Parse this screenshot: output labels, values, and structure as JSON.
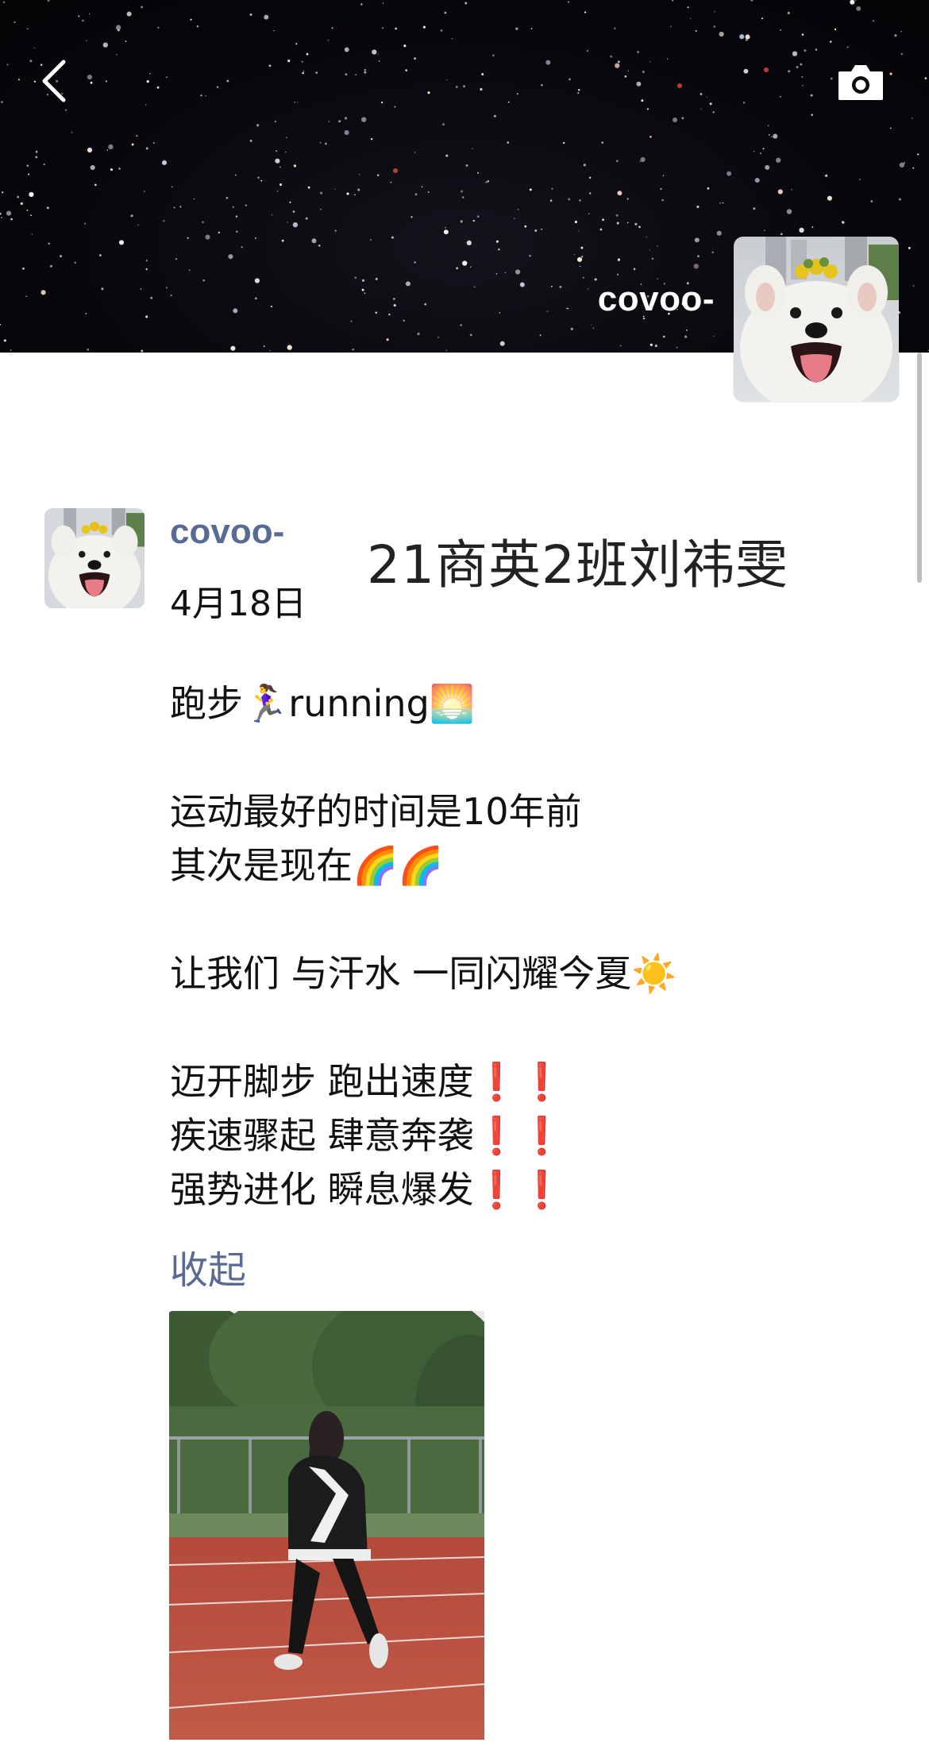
{
  "header": {
    "username": "covoo-",
    "background": "starry-night-sky",
    "icons": {
      "back": "chevron-left-icon",
      "camera": "camera-icon"
    }
  },
  "post": {
    "username": "covoo-",
    "date": "4月18日",
    "title_overlay": "21商英2班刘祎雯",
    "lines": [
      "跑步🏃‍♀️running🌅",
      "",
      "运动最好的时间是10年前",
      "其次是现在🌈🌈",
      "",
      "让我们 与汗水 一同闪耀今夏☀️",
      "",
      "迈开脚步 跑出速度❗❗",
      "疾速骤起 肆意奔袭❗❗",
      "强势进化 瞬息爆发❗❗"
    ],
    "collapse_label": "收起",
    "photo": "girl-running-on-red-track"
  },
  "colors": {
    "link": "#576b95",
    "text": "#111111",
    "header_bg": "#07060a",
    "exclaim": "#e0231d"
  }
}
